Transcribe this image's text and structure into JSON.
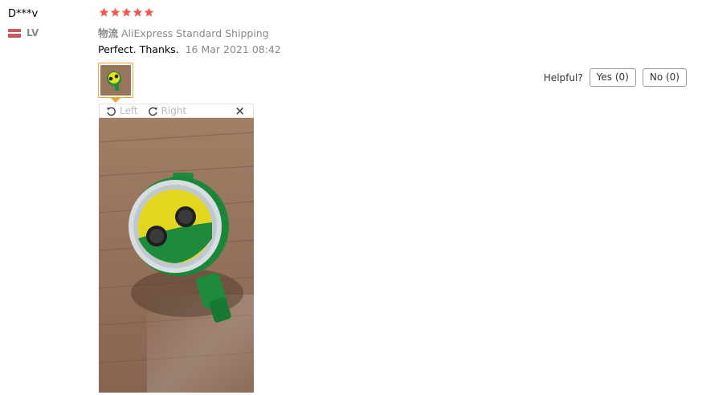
{
  "review": {
    "user_name": "D***v",
    "country_code": "LV",
    "rating": 5,
    "shipping_label": "物流",
    "shipping_method": "AliExpress Standard Shipping",
    "text": "Perfect. Thanks.",
    "date": "16 Mar 2021 08:42"
  },
  "viewer": {
    "rotate_left_label": "Left",
    "rotate_right_label": "Right",
    "close_glyph": "×"
  },
  "helpful": {
    "label": "Helpful?",
    "yes_label": "Yes (0)",
    "no_label": "No (0)"
  },
  "colors": {
    "star": "#f5574d",
    "thumb_border": "#e8a33c",
    "flag": "#c95a5f"
  },
  "icons": [
    "star-icon",
    "rotate-left-icon",
    "rotate-right-icon",
    "close-icon",
    "flag-icon"
  ]
}
